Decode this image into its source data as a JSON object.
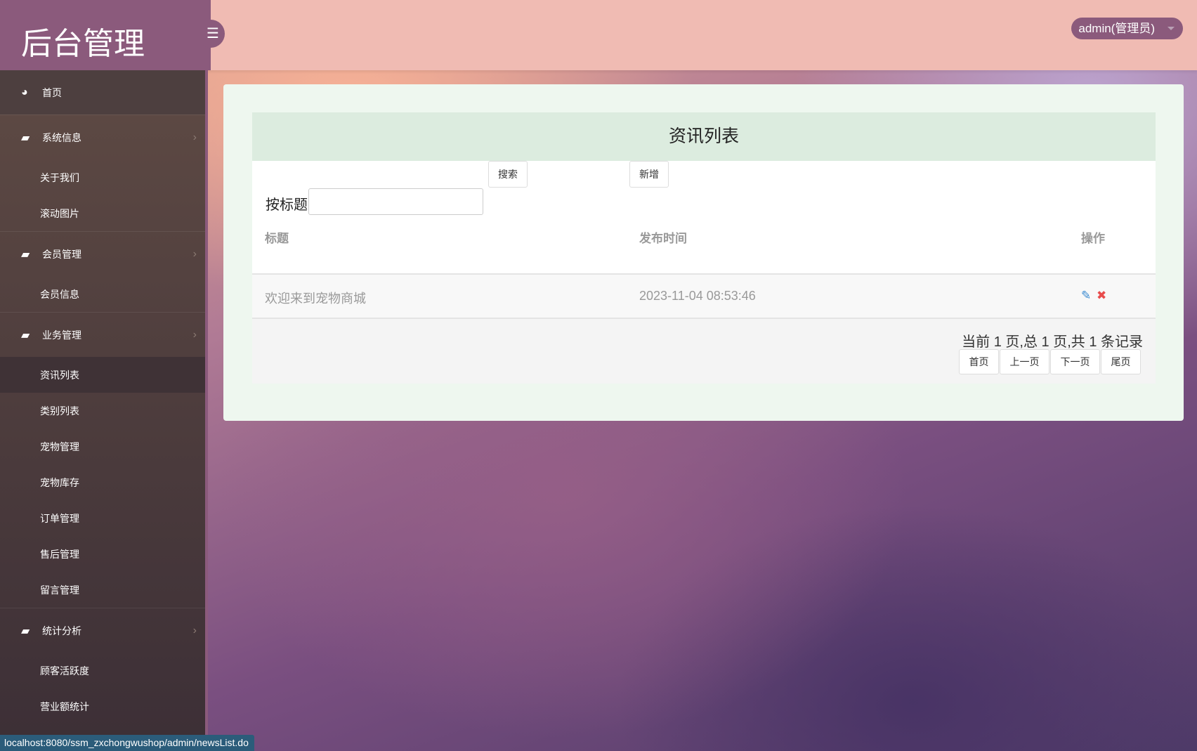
{
  "header": {
    "logo": "后台管理",
    "user": "admin(管理员)"
  },
  "sidebar": {
    "home": "首页",
    "groups": [
      {
        "label": "系统信息",
        "items": [
          "关于我们",
          "滚动图片"
        ]
      },
      {
        "label": "会员管理",
        "items": [
          "会员信息"
        ]
      },
      {
        "label": "业务管理",
        "items": [
          "资讯列表",
          "类别列表",
          "宠物管理",
          "宠物库存",
          "订单管理",
          "售后管理",
          "留言管理"
        ]
      },
      {
        "label": "统计分析",
        "items": [
          "顾客活跃度",
          "营业额统计"
        ]
      }
    ]
  },
  "main": {
    "title": "资讯列表",
    "search_label": "按标题",
    "search_value": "",
    "search_button": "搜索",
    "add_button": "新增",
    "columns": [
      "标题",
      "发布时间",
      "操作"
    ],
    "rows": [
      {
        "title": "欢迎来到宠物商城",
        "time": "2023-11-04 08:53:46"
      }
    ],
    "pagination": {
      "info": "当前 1 页,总 1 页,共 1 条记录",
      "buttons": [
        "首页",
        "上一页",
        "下一页",
        "尾页"
      ]
    }
  },
  "status_url": "localhost:8080/ssm_zxchongwushop/admin/newsList.do"
}
